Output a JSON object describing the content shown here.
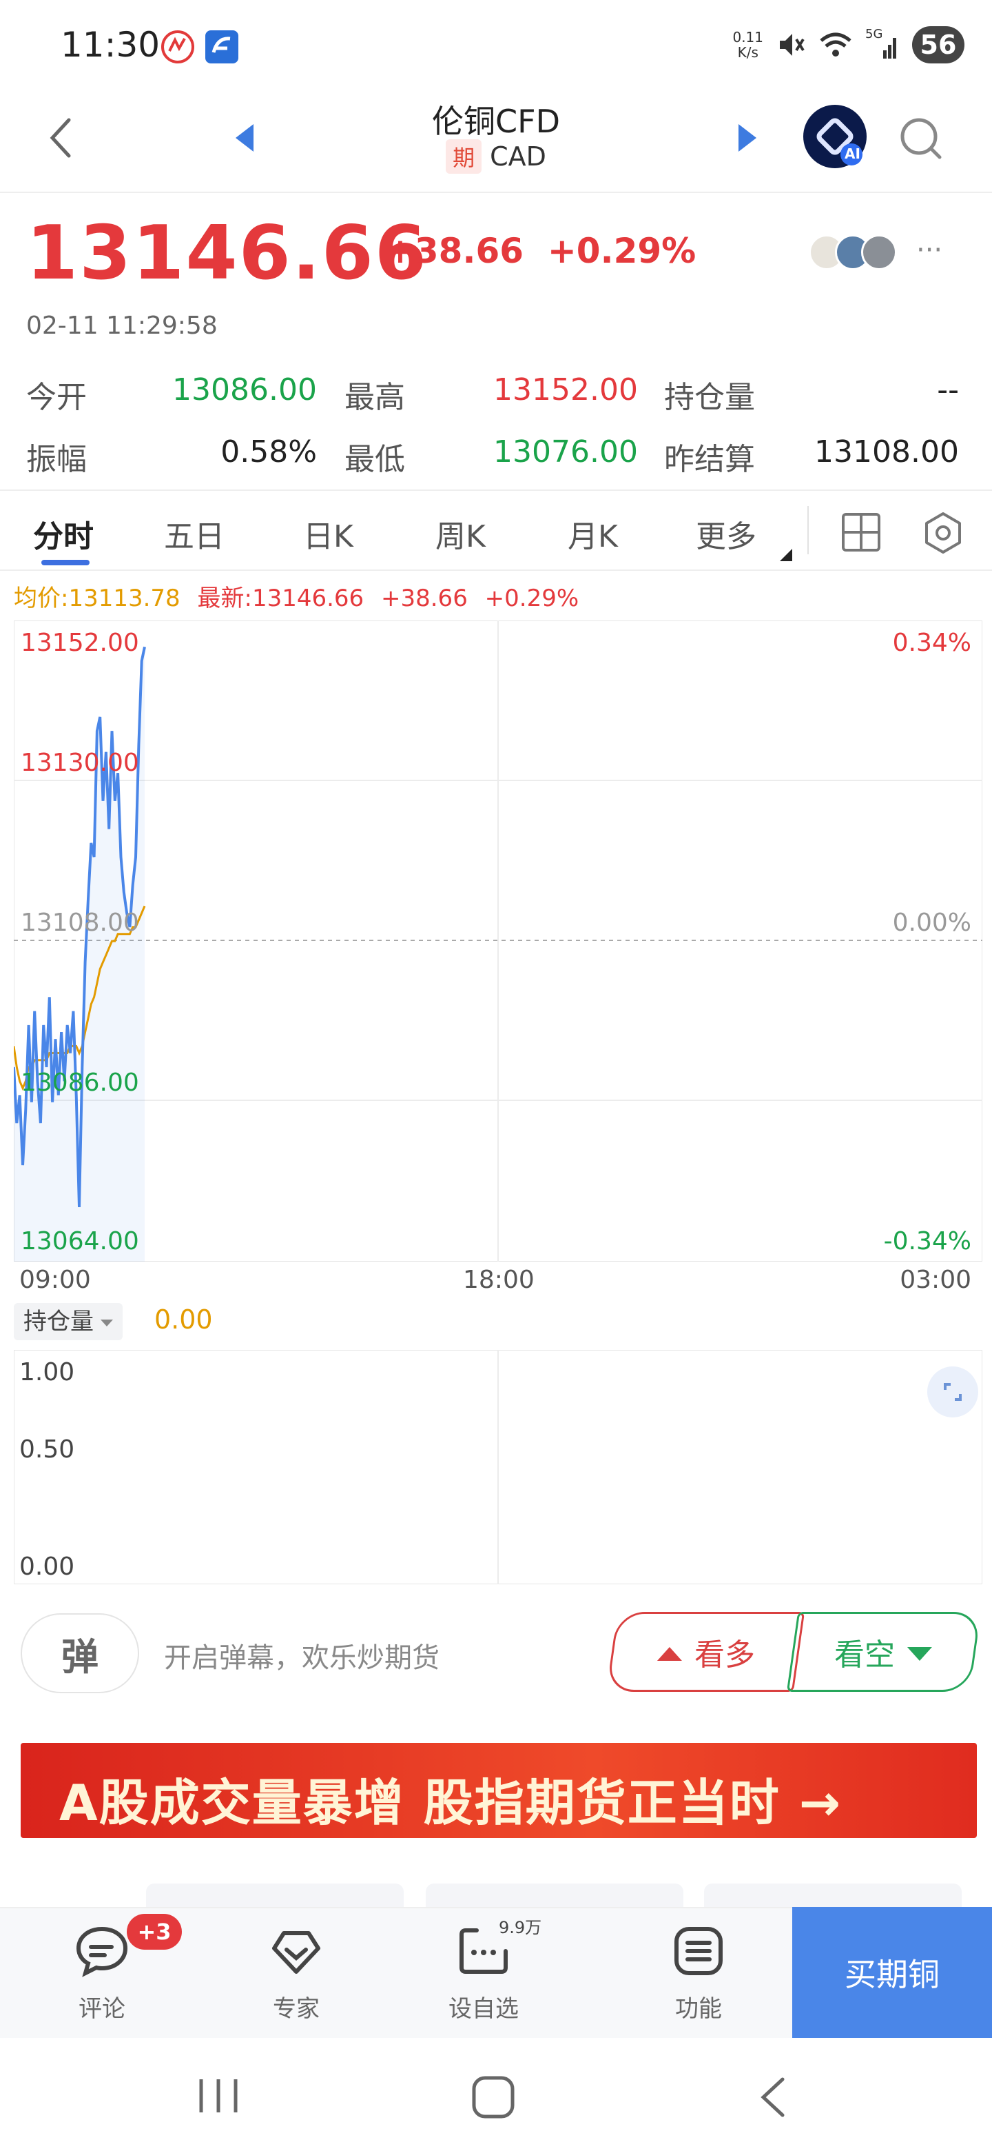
{
  "status_bar": {
    "time": "11:30",
    "net_speed_value": "0.11",
    "net_speed_unit": "K/s",
    "network": "5G",
    "battery": "56",
    "icons": [
      "mute-icon",
      "wifi-icon",
      "signal-icon",
      "battery-icon"
    ]
  },
  "header": {
    "title": "伦铜CFD",
    "tag": "期",
    "subtitle": "CAD",
    "ai_label": "AI"
  },
  "quote": {
    "price": "13146.66",
    "change": "+38.66",
    "change_pct": "+0.29%",
    "timestamp": "02-11 11:29:58",
    "more": "···"
  },
  "stats": {
    "open_label": "今开",
    "open_value": "13086.00",
    "high_label": "最高",
    "high_value": "13152.00",
    "oi_label": "持仓量",
    "oi_value": "--",
    "amp_label": "振幅",
    "amp_value": "0.58%",
    "low_label": "最低",
    "low_value": "13076.00",
    "settle_label": "昨结算",
    "settle_value": "13108.00"
  },
  "tabs": [
    "分时",
    "五日",
    "日K",
    "周K",
    "月K",
    "更多"
  ],
  "info_line": {
    "avg": "均价:13113.78",
    "latest": "最新:13146.66",
    "change": "+38.66",
    "change_pct": "+0.29%"
  },
  "chart_data": {
    "type": "line",
    "y_labels": [
      "13152.00",
      "13130.00",
      "13108.00",
      "13086.00",
      "13064.00"
    ],
    "pct_labels": [
      "0.34%",
      "0.00%",
      "-0.34%"
    ],
    "x_labels": [
      "09:00",
      "18:00",
      "03:00"
    ],
    "ylim": [
      13064,
      13152
    ],
    "reference": 13108,
    "series": [
      {
        "values": [
          13090,
          13082,
          13086,
          13076,
          13084,
          13096,
          13085,
          13098,
          13088,
          13082,
          13096,
          13090,
          13100,
          13085,
          13094,
          13086,
          13095,
          13088,
          13096,
          13092,
          13098,
          13086,
          13070,
          13090,
          13105,
          13114,
          13122,
          13120,
          13138,
          13140,
          13128,
          13135,
          13124,
          13138,
          13128,
          13132,
          13120,
          13115,
          13112,
          13110,
          13116,
          13120,
          13136,
          13148,
          13150
        ]
      },
      {
        "values": [
          13093,
          13090,
          13088,
          13087,
          13088,
          13090,
          13090,
          13091,
          13091,
          13091,
          13091,
          13091,
          13092,
          13092,
          13092,
          13092,
          13092,
          13092,
          13092,
          13093,
          13093,
          13093,
          13092,
          13093,
          13095,
          13097,
          13099,
          13100,
          13102,
          13104,
          13105,
          13106,
          13107,
          13108,
          13108,
          13109,
          13109,
          13109,
          13109,
          13109,
          13110,
          13110,
          13111,
          13112,
          13113
        ]
      }
    ],
    "colors": {
      "price": "#4a86e8",
      "avg": "#e39b00",
      "up": "#e4393c",
      "down": "#1aa34a"
    }
  },
  "position": {
    "selector_label": "持仓量",
    "value": "0.00",
    "y_labels": [
      "1.00",
      "0.50",
      "0.00"
    ]
  },
  "actions": {
    "danmu_icon": "弹",
    "danmu_text": "开启弹幕，欢乐炒期货",
    "bull": "看多",
    "bear": "看空"
  },
  "banner": {
    "text": "A股成交量暴增 股指期货正当时 →"
  },
  "bottom_nav": {
    "items": [
      {
        "label": "评论",
        "icon": "comment-icon"
      },
      {
        "label": "专家",
        "icon": "expert-icon"
      },
      {
        "label": "设自选",
        "icon": "watchlist-icon"
      },
      {
        "label": "功能",
        "icon": "function-icon"
      }
    ],
    "badge": "+3",
    "watch_count": "9.9万",
    "buy": "买期铜"
  }
}
